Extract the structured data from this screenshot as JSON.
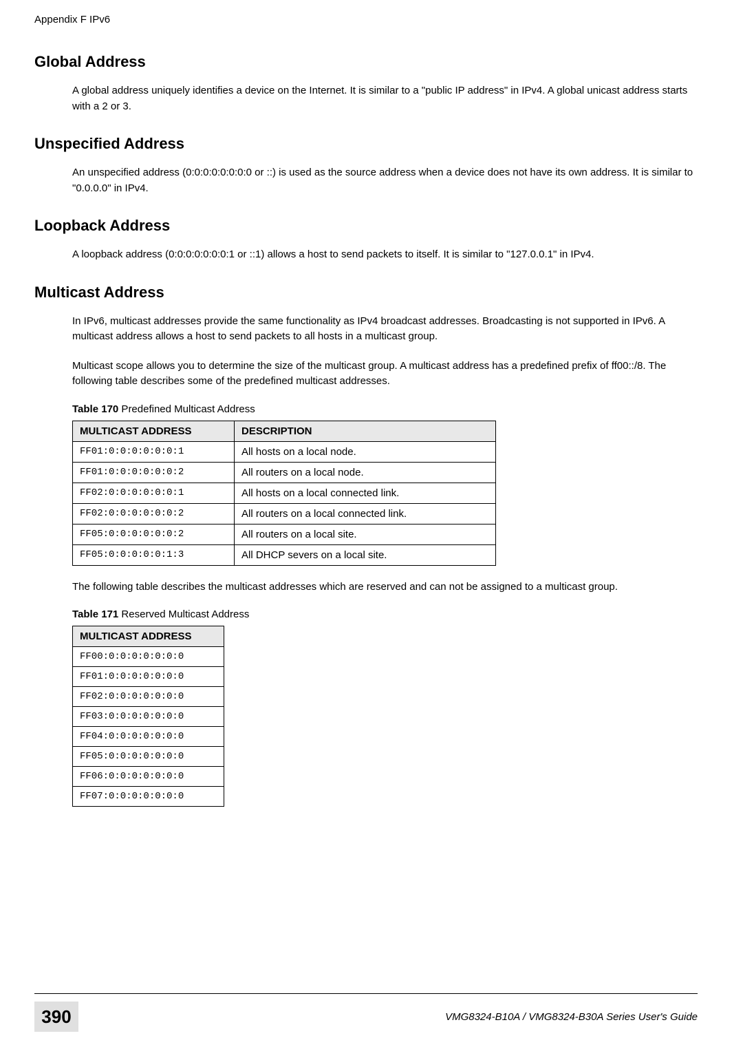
{
  "header": {
    "left": "Appendix F IPv6"
  },
  "sections": {
    "global": {
      "title": "Global Address",
      "body": "A global address uniquely identifies a device on the Internet. It is similar to a \"public IP address\" in IPv4. A global unicast address starts with a 2 or 3."
    },
    "unspecified": {
      "title": "Unspecified Address",
      "body": "An unspecified address (0:0:0:0:0:0:0:0 or ::) is used as the source address when a device does not have its own address. It is similar to \"0.0.0.0\" in IPv4."
    },
    "loopback": {
      "title": "Loopback Address",
      "body": "A loopback address (0:0:0:0:0:0:0:1 or ::1) allows a host to send packets to itself. It is similar to \"127.0.0.1\" in IPv4."
    },
    "multicast": {
      "title": "Multicast Address",
      "body1": "In IPv6, multicast addresses provide the same functionality as IPv4 broadcast addresses. Broadcasting is not supported in IPv6. A multicast address allows a host to send packets to all hosts in a multicast group.",
      "body2": "Multicast scope allows you to determine the size of the multicast group. A multicast address has a predefined prefix of ff00::/8. The following table describes some of the predefined multicast addresses.",
      "body3": "The following table describes the multicast addresses which are reserved and can not be assigned to a multicast group."
    }
  },
  "table170": {
    "label_bold": "Table 170",
    "label_rest": "   Predefined Multicast Address",
    "headers": {
      "c1": "MULTICAST ADDRESS",
      "c2": "DESCRIPTION"
    },
    "rows": [
      {
        "addr": "FF01:0:0:0:0:0:0:1",
        "desc": "All hosts on a local node."
      },
      {
        "addr": "FF01:0:0:0:0:0:0:2",
        "desc": "All routers on a local node."
      },
      {
        "addr": "FF02:0:0:0:0:0:0:1",
        "desc": "All hosts on a local connected link."
      },
      {
        "addr": "FF02:0:0:0:0:0:0:2",
        "desc": "All routers on a local connected link."
      },
      {
        "addr": "FF05:0:0:0:0:0:0:2",
        "desc": "All routers on a local site."
      },
      {
        "addr": "FF05:0:0:0:0:0:1:3",
        "desc": "All DHCP severs on a local site."
      }
    ]
  },
  "table171": {
    "label_bold": "Table 171",
    "label_rest": "   Reserved Multicast Address",
    "header": "MULTICAST ADDRESS",
    "rows": [
      "FF00:0:0:0:0:0:0:0",
      "FF01:0:0:0:0:0:0:0",
      "FF02:0:0:0:0:0:0:0",
      "FF03:0:0:0:0:0:0:0",
      "FF04:0:0:0:0:0:0:0",
      "FF05:0:0:0:0:0:0:0",
      "FF06:0:0:0:0:0:0:0",
      "FF07:0:0:0:0:0:0:0"
    ]
  },
  "footer": {
    "page": "390",
    "title": "VMG8324-B10A / VMG8324-B30A Series User's Guide"
  }
}
